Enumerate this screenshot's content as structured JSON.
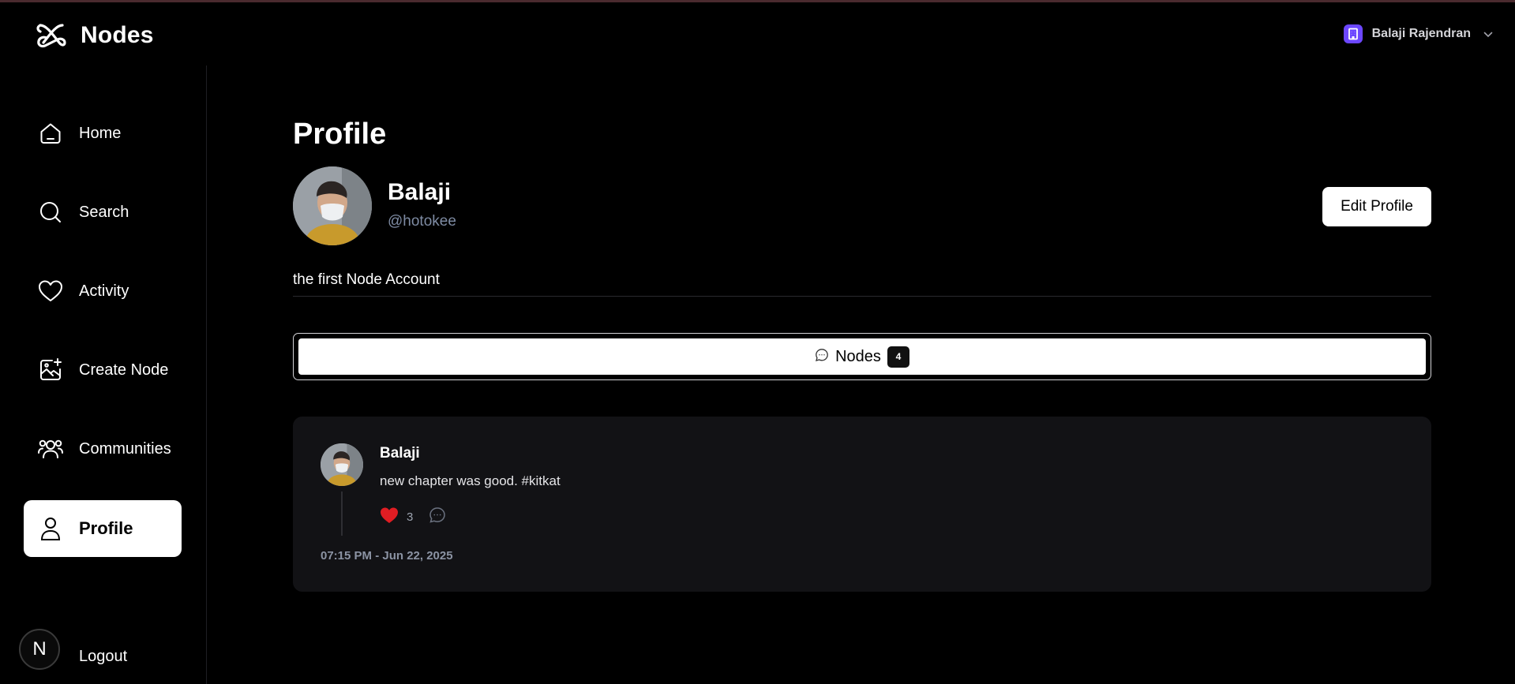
{
  "app": {
    "name": "Nodes"
  },
  "user_menu": {
    "name": "Balaji Rajendran"
  },
  "sidebar": {
    "items": [
      {
        "label": "Home",
        "icon": "home-icon"
      },
      {
        "label": "Search",
        "icon": "search-icon"
      },
      {
        "label": "Activity",
        "icon": "heart-icon"
      },
      {
        "label": "Create Node",
        "icon": "image-plus-icon"
      },
      {
        "label": "Communities",
        "icon": "users-icon"
      },
      {
        "label": "Profile",
        "icon": "user-icon",
        "active": true
      }
    ],
    "logout_label": "Logout",
    "framework_badge": "N"
  },
  "profile": {
    "page_title": "Profile",
    "name": "Balaji",
    "handle": "@hotokee",
    "bio": "the first Node Account",
    "edit_label": "Edit Profile"
  },
  "tabs": [
    {
      "label": "Nodes",
      "count": "4",
      "icon": "message-circle-icon"
    }
  ],
  "posts": [
    {
      "author": "Balaji",
      "text": "new chapter was good. #kitkat",
      "likes": "3",
      "date": "07:15 PM - Jun 22, 2025"
    }
  ],
  "colors": {
    "background": "#000000",
    "card": "#121215",
    "handle": "#7e8ba3",
    "like": "#e11d23",
    "org_badge": "#6c47ff"
  }
}
